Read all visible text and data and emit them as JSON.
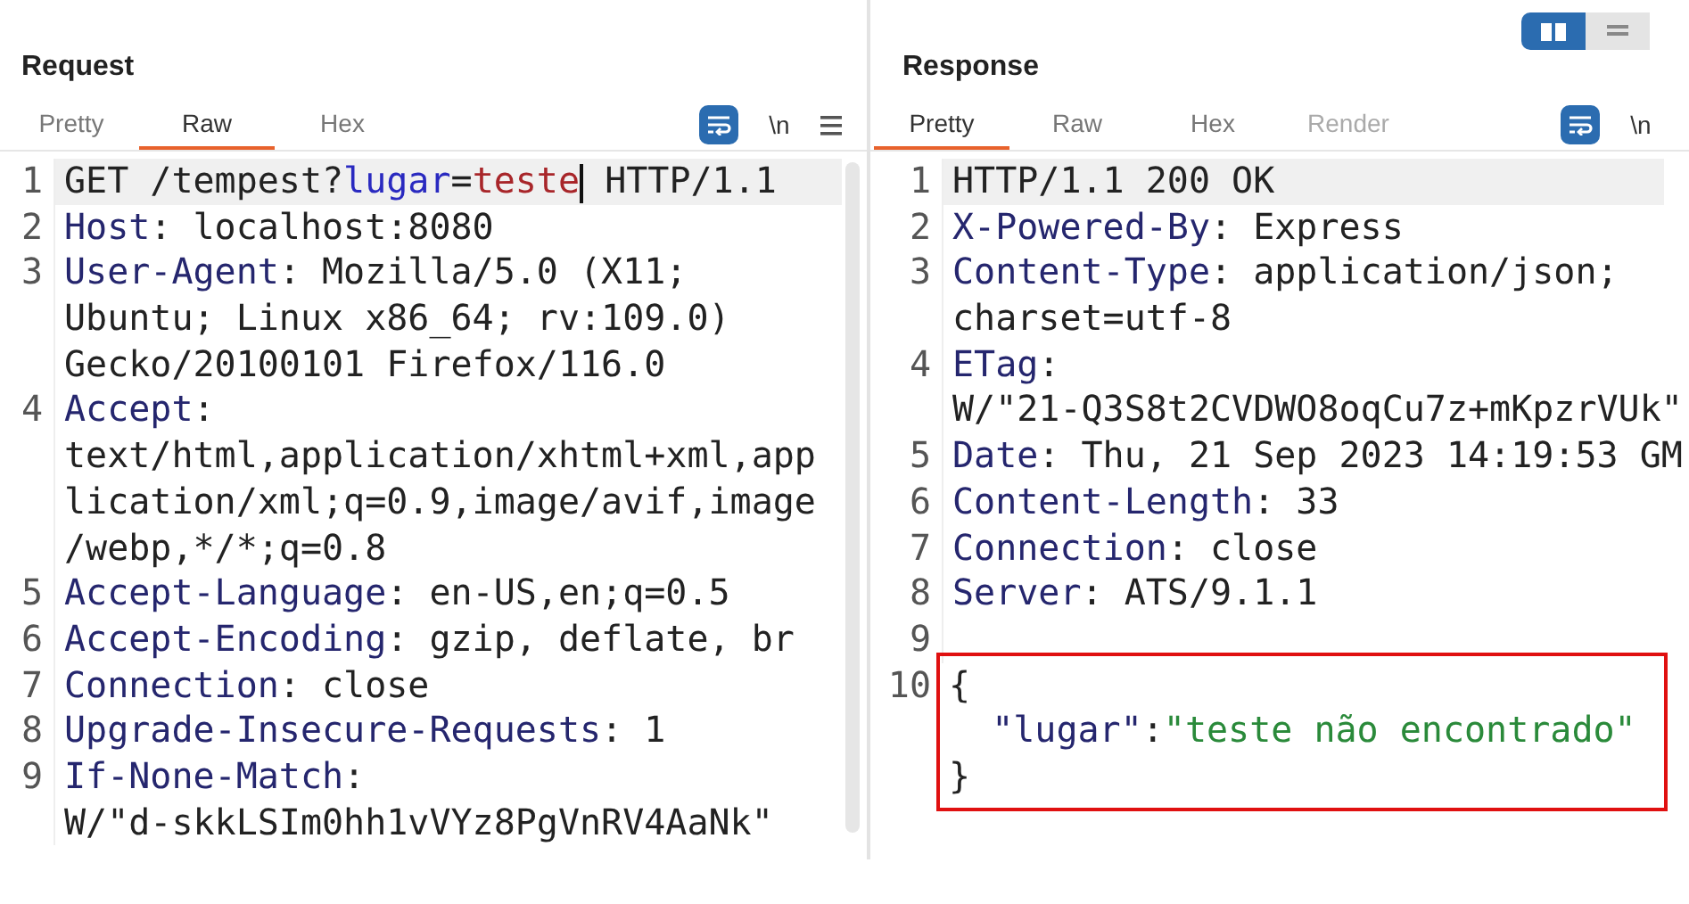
{
  "panes": [
    {
      "title": "Request",
      "tabs": [
        {
          "label": "Pretty",
          "selected": false,
          "disabled": false
        },
        {
          "label": "Raw",
          "selected": true,
          "disabled": false
        },
        {
          "label": "Hex",
          "selected": false,
          "disabled": false
        }
      ],
      "tools": [
        {
          "kind": "wrap",
          "on": true
        },
        {
          "kind": "newline",
          "label": "\\n"
        },
        {
          "kind": "menu"
        }
      ],
      "scrollbar": true,
      "rows": [
        {
          "number": "1",
          "current": true,
          "highlighted": false,
          "parts": [
            {
              "kind": "plain",
              "text": "GET /tempest?"
            },
            {
              "kind": "param",
              "text": "lugar"
            },
            {
              "kind": "plain",
              "text": "="
            },
            {
              "kind": "value",
              "text": "teste",
              "caret_after": true
            },
            {
              "kind": "plain",
              "text": " HTTP/1.1"
            }
          ]
        },
        {
          "number": "2",
          "current": false,
          "highlighted": false,
          "parts": [
            {
              "kind": "key",
              "text": "Host"
            },
            {
              "kind": "plain",
              "text": ": localhost:8080"
            }
          ]
        },
        {
          "number": "3",
          "current": false,
          "highlighted": false,
          "parts": [
            {
              "kind": "key",
              "text": "User-Agent"
            },
            {
              "kind": "plain",
              "text": ": Mozilla/5.0 (X11;"
            }
          ]
        },
        {
          "current": false,
          "highlighted": false,
          "parts": [
            {
              "kind": "plain",
              "text": "Ubuntu; Linux x86_64; rv:109.0)"
            }
          ]
        },
        {
          "current": false,
          "highlighted": false,
          "parts": [
            {
              "kind": "plain",
              "text": "Gecko/20100101 Firefox/116.0"
            }
          ]
        },
        {
          "number": "4",
          "current": false,
          "highlighted": false,
          "parts": [
            {
              "kind": "key",
              "text": "Accept"
            },
            {
              "kind": "plain",
              "text": ":"
            }
          ]
        },
        {
          "current": false,
          "highlighted": false,
          "parts": [
            {
              "kind": "plain",
              "text": "text/html,application/xhtml+xml,app"
            }
          ]
        },
        {
          "current": false,
          "highlighted": false,
          "parts": [
            {
              "kind": "plain",
              "text": "lication/xml;q=0.9,image/avif,image"
            }
          ]
        },
        {
          "current": false,
          "highlighted": false,
          "parts": [
            {
              "kind": "plain",
              "text": "/webp,*/*;q=0.8"
            }
          ]
        },
        {
          "number": "5",
          "current": false,
          "highlighted": false,
          "parts": [
            {
              "kind": "key",
              "text": "Accept-Language"
            },
            {
              "kind": "plain",
              "text": ": en-US,en;q=0.5"
            }
          ]
        },
        {
          "number": "6",
          "current": false,
          "highlighted": false,
          "parts": [
            {
              "kind": "key",
              "text": "Accept-Encoding"
            },
            {
              "kind": "plain",
              "text": ": gzip, deflate, br"
            }
          ]
        },
        {
          "number": "7",
          "current": false,
          "highlighted": false,
          "parts": [
            {
              "kind": "key",
              "text": "Connection"
            },
            {
              "kind": "plain",
              "text": ": close"
            }
          ]
        },
        {
          "number": "8",
          "current": false,
          "highlighted": false,
          "parts": [
            {
              "kind": "key",
              "text": "Upgrade-Insecure-Requests"
            },
            {
              "kind": "plain",
              "text": ": 1"
            }
          ]
        },
        {
          "number": "9",
          "current": false,
          "highlighted": false,
          "parts": [
            {
              "kind": "key",
              "text": "If-None-Match"
            },
            {
              "kind": "plain",
              "text": ":"
            }
          ]
        },
        {
          "current": false,
          "highlighted": false,
          "parts": [
            {
              "kind": "plain",
              "text": "W/\"d-skkLSIm0hh1vVYz8PgVnRV4AaNk\""
            }
          ]
        }
      ]
    },
    {
      "title": "Response",
      "view_toggle": [
        {
          "kind": "columns",
          "selected": true
        },
        {
          "kind": "rows",
          "selected": false
        }
      ],
      "tabs": [
        {
          "label": "Pretty",
          "selected": true,
          "disabled": false
        },
        {
          "label": "Raw",
          "selected": false,
          "disabled": false
        },
        {
          "label": "Hex",
          "selected": false,
          "disabled": false
        },
        {
          "label": "Render",
          "selected": false,
          "disabled": true
        }
      ],
      "tools": [
        {
          "kind": "wrap",
          "on": true
        },
        {
          "kind": "newline",
          "label": "\\n"
        }
      ],
      "rows": [
        {
          "number": "1",
          "current": true,
          "highlighted": false,
          "parts": [
            {
              "kind": "plain",
              "text": "HTTP/1.1 200 OK"
            }
          ]
        },
        {
          "number": "2",
          "current": false,
          "highlighted": false,
          "parts": [
            {
              "kind": "key",
              "text": "X-Powered-By"
            },
            {
              "kind": "plain",
              "text": ": Express"
            }
          ]
        },
        {
          "number": "3",
          "current": false,
          "highlighted": false,
          "parts": [
            {
              "kind": "key",
              "text": "Content-Type"
            },
            {
              "kind": "plain",
              "text": ": application/json;"
            }
          ]
        },
        {
          "current": false,
          "highlighted": false,
          "parts": [
            {
              "kind": "plain",
              "text": "charset=utf-8"
            }
          ]
        },
        {
          "number": "4",
          "current": false,
          "highlighted": false,
          "parts": [
            {
              "kind": "key",
              "text": "ETag"
            },
            {
              "kind": "plain",
              "text": ":"
            }
          ]
        },
        {
          "current": false,
          "highlighted": false,
          "parts": [
            {
              "kind": "plain",
              "text": "W/\"21-Q3S8t2CVDWO8oqCu7z+mKpzrVUk\""
            }
          ]
        },
        {
          "number": "5",
          "current": false,
          "highlighted": false,
          "parts": [
            {
              "kind": "key",
              "text": "Date"
            },
            {
              "kind": "plain",
              "text": ": Thu, 21 Sep 2023 14:19:53 GM"
            }
          ]
        },
        {
          "number": "6",
          "current": false,
          "highlighted": false,
          "parts": [
            {
              "kind": "key",
              "text": "Content-Length"
            },
            {
              "kind": "plain",
              "text": ": 33"
            }
          ]
        },
        {
          "number": "7",
          "current": false,
          "highlighted": false,
          "parts": [
            {
              "kind": "key",
              "text": "Connection"
            },
            {
              "kind": "plain",
              "text": ": close"
            }
          ]
        },
        {
          "number": "8",
          "current": false,
          "highlighted": false,
          "parts": [
            {
              "kind": "key",
              "text": "Server"
            },
            {
              "kind": "plain",
              "text": ": ATS/9.1.1"
            }
          ]
        },
        {
          "number": "9",
          "current": false,
          "highlighted": false,
          "parts": []
        },
        {
          "number": "10",
          "current": false,
          "highlighted": true,
          "parts": [
            {
              "kind": "plain",
              "text": "{"
            }
          ]
        },
        {
          "current": false,
          "highlighted": true,
          "parts": [
            {
              "kind": "jsonkey",
              "text": "  \"lugar\""
            },
            {
              "kind": "plain",
              "text": ":"
            },
            {
              "kind": "string",
              "text": "\"teste não encontrado\""
            }
          ]
        },
        {
          "current": false,
          "highlighted": true,
          "parts": [
            {
              "kind": "plain",
              "text": "}"
            }
          ]
        }
      ]
    }
  ]
}
